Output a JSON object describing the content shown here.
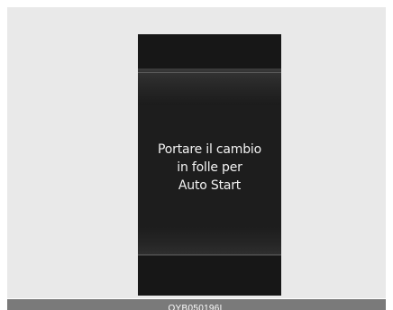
{
  "display": {
    "message_lines": [
      "Portare il cambio",
      "in folle per",
      "Auto Start"
    ]
  },
  "caption": {
    "code": "OYB050196L"
  }
}
